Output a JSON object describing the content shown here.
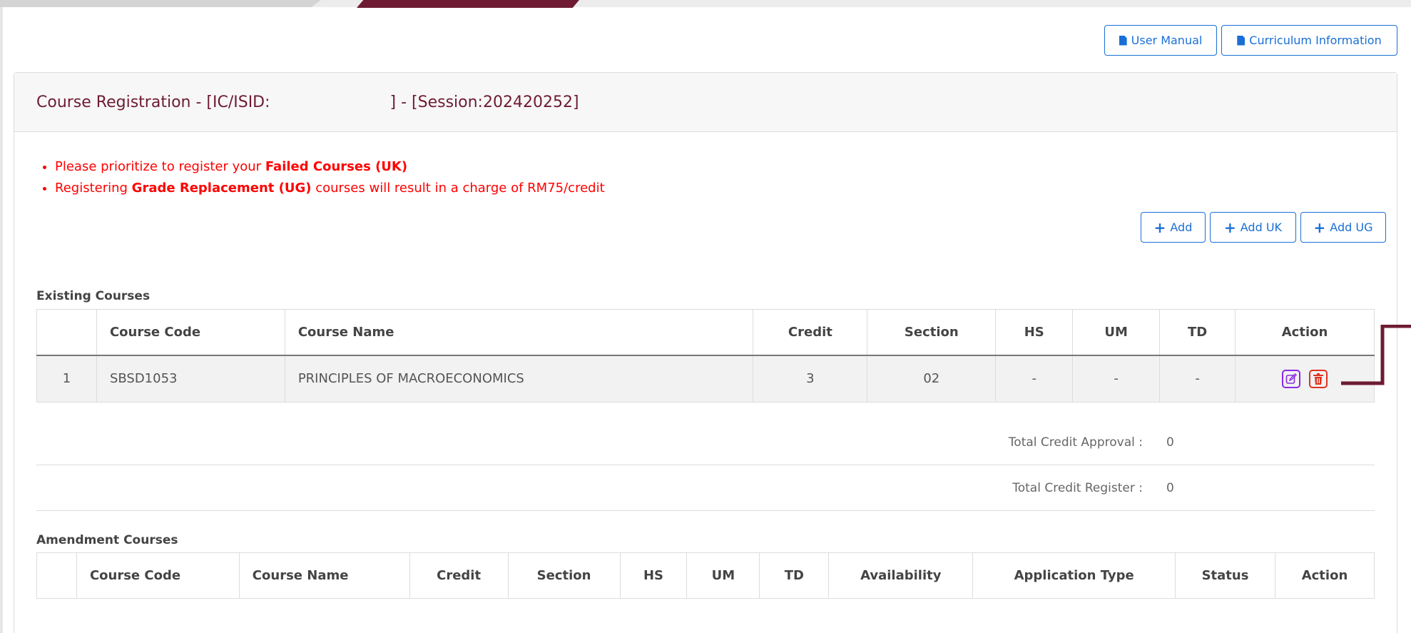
{
  "header_buttons": {
    "user_manual": "User Manual",
    "curriculum": "Curriculum Information"
  },
  "card": {
    "title_prefix": "Course Registration - [IC/ISID:",
    "title_suffix": "] - [Session:202420252]"
  },
  "notices": {
    "line1_prefix": "Please prioritize to register your ",
    "line1_bold": "Failed Courses (UK)",
    "line2_prefix": "Registering ",
    "line2_bold": "Grade Replacement (UG)",
    "line2_suffix": " courses will result in a charge of RM75/credit"
  },
  "add_buttons": {
    "add": "Add",
    "add_uk": "Add UK",
    "add_ug": "Add UG"
  },
  "existing": {
    "label": "Existing Courses",
    "columns": [
      "",
      "Course Code",
      "Course Name",
      "Credit",
      "Section",
      "HS",
      "UM",
      "TD",
      "Action"
    ],
    "rows": [
      {
        "no": "1",
        "code": "SBSD1053",
        "name": "PRINCIPLES OF MACROECONOMICS",
        "credit": "3",
        "section": "02",
        "hs": "-",
        "um": "-",
        "td": "-"
      }
    ]
  },
  "totals": {
    "approval_label": "Total Credit Approval :",
    "approval_value": "0",
    "register_label": "Total Credit Register :",
    "register_value": "0"
  },
  "amendment": {
    "label": "Amendment Courses",
    "columns": [
      "",
      "Course Code",
      "Course Name",
      "Credit",
      "Section",
      "HS",
      "UM",
      "TD",
      "Availability",
      "Application Type",
      "Status",
      "Action"
    ]
  },
  "icons": [
    "file-icon",
    "plus-icon",
    "edit-icon",
    "trash-icon"
  ],
  "colors": {
    "brand_maroon": "#6e1b33",
    "link_blue": "#1a6fd6",
    "notice_red": "#ff0000",
    "edit_purple": "#8a2be2",
    "delete_red": "#e0321e"
  }
}
